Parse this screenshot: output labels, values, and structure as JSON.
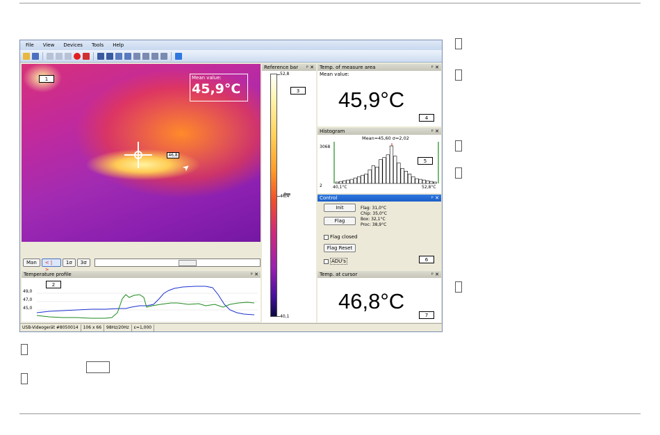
{
  "menu": [
    "File",
    "View",
    "Devices",
    "Tools",
    "Help"
  ],
  "image_view": {
    "label_1": "1",
    "mean_label": "Mean value:",
    "mean_value": "45,9°C",
    "cursor_tag": "46,8"
  },
  "controls": {
    "buttons": [
      "Man",
      "< | >",
      "1σ",
      "3σ"
    ]
  },
  "temperature_profile": {
    "title": "Temperature profile",
    "label": "2",
    "y_ticks": [
      "49,0",
      "47,0",
      "45,0"
    ]
  },
  "reference_bar": {
    "title": "Reference bar",
    "label": "3",
    "max": "52,8",
    "mid": "46,4",
    "min": "40,1"
  },
  "measure_area": {
    "title": "Temp. of measure area",
    "sub": "Mean value:",
    "value": "45,9°C",
    "label": "4"
  },
  "histogram": {
    "title": "Histogram",
    "stats": "Mean=45,60   σ=2,02",
    "ymax": "3068",
    "ymin": "2",
    "xmin": "40,1°C",
    "xmax": "52,8°C",
    "label": "5",
    "bins": [
      2,
      3,
      4,
      5,
      6,
      8,
      10,
      12,
      14,
      20,
      26,
      24,
      35,
      38,
      42,
      55,
      40,
      30,
      22,
      18,
      14,
      10,
      7,
      6,
      5,
      4,
      3,
      2
    ]
  },
  "control_panel": {
    "title": "Control",
    "init": "Init",
    "flag": "Flag",
    "flag_closed": "Flag closed",
    "flag_reset": "Flag Reset",
    "adus": "ADU's",
    "label": "6",
    "info": [
      "Flag:   31,0°C",
      "Chip:   35,0°C",
      "Box:    32,1°C",
      "Proc:   38,9°C"
    ]
  },
  "cursor_temp": {
    "title": "Temp. at cursor",
    "value": "46,8°C",
    "label": "7"
  },
  "status": [
    "USB-Videogerät #8050014",
    "106 x 66",
    "98Hz/20Hz",
    "ε=1,000"
  ],
  "colors": {
    "profile_blue": "#1a2fd0",
    "profile_green": "#1d8a1d",
    "hist_red": "#e02020",
    "hist_green": "#1d8a1d"
  }
}
